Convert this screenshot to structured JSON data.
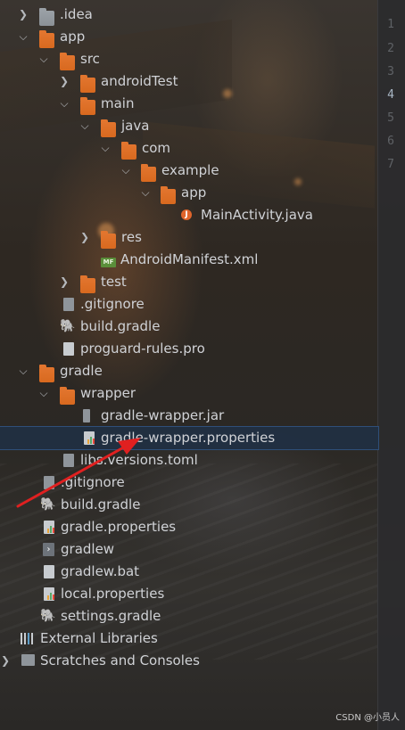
{
  "gutter": {
    "line_numbers": [
      "1",
      "2",
      "3",
      "4",
      "5",
      "6",
      "7"
    ]
  },
  "tree": {
    "items": [
      {
        "label": ".idea",
        "icon": "folder-grey-icon",
        "expanded": false
      },
      {
        "label": "app",
        "icon": "folder-icon",
        "expanded": true
      },
      {
        "label": "src",
        "icon": "folder-icon",
        "expanded": true
      },
      {
        "label": "androidTest",
        "icon": "folder-icon",
        "expanded": false
      },
      {
        "label": "main",
        "icon": "folder-icon",
        "expanded": true
      },
      {
        "label": "java",
        "icon": "folder-icon",
        "expanded": true
      },
      {
        "label": "com",
        "icon": "folder-icon",
        "expanded": true
      },
      {
        "label": "example",
        "icon": "folder-icon",
        "expanded": true
      },
      {
        "label": "app",
        "icon": "folder-icon",
        "expanded": true
      },
      {
        "label": "MainActivity.java",
        "icon": "java-file-icon"
      },
      {
        "label": "res",
        "icon": "folder-icon",
        "expanded": false
      },
      {
        "label": "AndroidManifest.xml",
        "icon": "manifest-file-icon"
      },
      {
        "label": "test",
        "icon": "folder-icon",
        "expanded": false
      },
      {
        "label": ".gitignore",
        "icon": "gitignore-file-icon"
      },
      {
        "label": "build.gradle",
        "icon": "gradle-elephant-icon"
      },
      {
        "label": "proguard-rules.pro",
        "icon": "text-file-icon"
      },
      {
        "label": "gradle",
        "icon": "folder-icon",
        "expanded": true
      },
      {
        "label": "wrapper",
        "icon": "folder-icon",
        "expanded": true
      },
      {
        "label": "gradle-wrapper.jar",
        "icon": "jar-file-icon"
      },
      {
        "label": "gradle-wrapper.properties",
        "icon": "properties-file-icon",
        "selected": true
      },
      {
        "label": "libs.versions.toml",
        "icon": "toml-file-icon"
      },
      {
        "label": ".gitignore",
        "icon": "gitignore-file-icon"
      },
      {
        "label": "build.gradle",
        "icon": "gradle-elephant-icon"
      },
      {
        "label": "gradle.properties",
        "icon": "properties-file-icon"
      },
      {
        "label": "gradlew",
        "icon": "terminal-file-icon"
      },
      {
        "label": "gradlew.bat",
        "icon": "text-file-icon"
      },
      {
        "label": "local.properties",
        "icon": "properties-file-icon"
      },
      {
        "label": "settings.gradle",
        "icon": "gradle-elephant-icon"
      },
      {
        "label": "External Libraries",
        "icon": "libraries-icon",
        "expanded": false
      },
      {
        "label": "Scratches and Consoles",
        "icon": "scratches-icon",
        "expanded": false
      }
    ]
  },
  "annotation": {
    "color": "#e02020"
  },
  "watermark": "CSDN @小员人",
  "colors": {
    "selection": "#212f42",
    "folder": "#e2752e"
  }
}
